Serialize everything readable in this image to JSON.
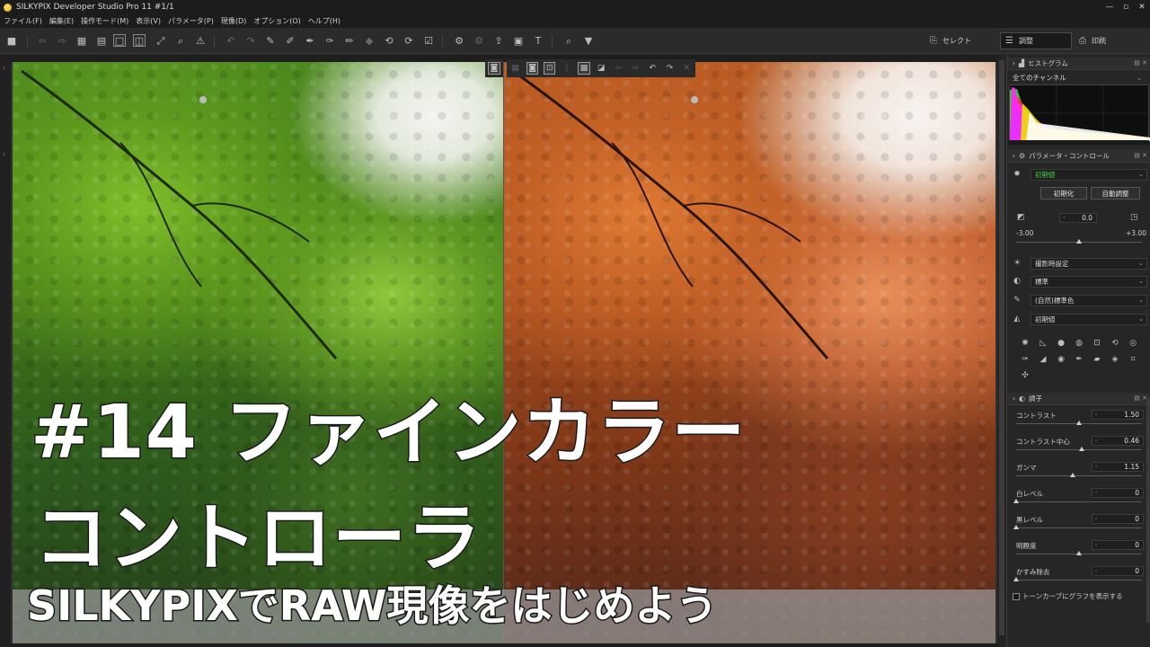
{
  "window": {
    "title": "SILKYPIX Developer Studio Pro 11   #1/1",
    "controls": [
      "—",
      "▫",
      "✕"
    ]
  },
  "menu": [
    "ファイル(F)",
    "編集(E)",
    "操作モード(M)",
    "表示(V)",
    "パラメータ(P)",
    "現像(D)",
    "オプション(O)",
    "ヘルプ(H)"
  ],
  "toolbar": {
    "mode_select": "セレクト",
    "mode_adjust": "調整",
    "mode_print": "印刷"
  },
  "overlay": {
    "line1": "#14 ファインカラー",
    "line2": "コントローラ",
    "line3": "SILKYPIXでRAW現像をはじめよう"
  },
  "panel": {
    "histogram": {
      "title": "ヒストグラム",
      "channel": "全てのチャンネル"
    },
    "param_control": {
      "title": "パラメータ・コントロール",
      "preset": "初期値",
      "btn_init": "初期化",
      "btn_auto": "自動調整",
      "exposure_value": "0.0",
      "exposure_min": "-3.00",
      "exposure_max": "+3.00",
      "exposure_level": 0.5,
      "white_balance": "撮影時設定",
      "tone": "標準",
      "color": "(自然)標準色",
      "sharpness": "初期値"
    },
    "tone_section": {
      "title": "調子",
      "rows": [
        {
          "label": "コントラスト",
          "value": "1.50"
        },
        {
          "label": "コントラスト中心",
          "value": "0.46"
        },
        {
          "label": "ガンマ",
          "value": "1.15"
        },
        {
          "label": "白レベル",
          "value": "0"
        },
        {
          "label": "黒レベル",
          "value": "0"
        },
        {
          "label": "明瞭度",
          "value": "0"
        },
        {
          "label": "かすみ除去",
          "value": "0"
        }
      ],
      "checkbox": "トーンカーブにグラフを表示する"
    }
  },
  "colors": {
    "accent_green": "#3fd04a",
    "background": "#262626"
  }
}
